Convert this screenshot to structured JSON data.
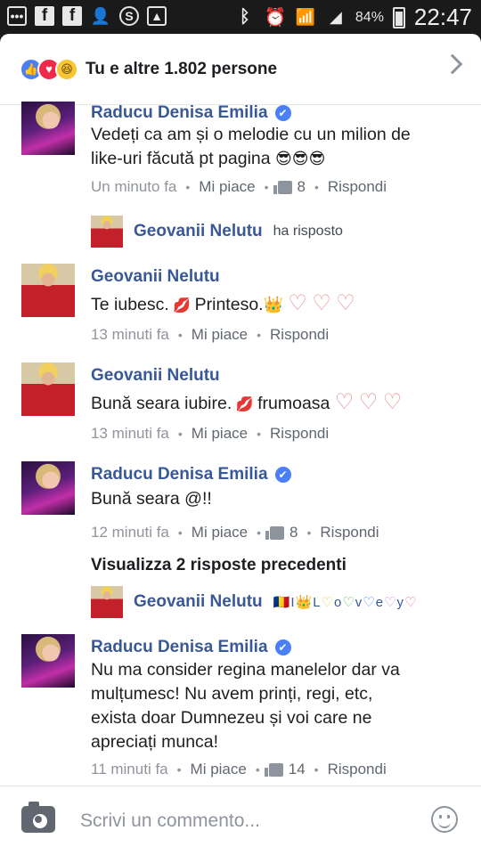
{
  "status_bar": {
    "time": "22:47",
    "battery": "84%",
    "left_icons": [
      "message-icon",
      "facebook-icon",
      "facebook-icon",
      "add-user-icon",
      "skype-icon",
      "gallery-icon"
    ],
    "right_icons": [
      "bluetooth-icon",
      "alarm-icon",
      "wifi-icon",
      "signal-icon",
      "battery-icon"
    ]
  },
  "reactions": {
    "icons": [
      "like",
      "love",
      "haha"
    ],
    "text": "Tu e altre 1.802 persone"
  },
  "comments": [
    {
      "author": "Raducu Denisa Emilia",
      "verified": true,
      "line1": "Vedeți ca am și o melodie cu un milion de",
      "line2": "like-uri făcută pt pagina",
      "emojis": "😎😎😎",
      "time": "Un minuto fa",
      "like_label": "Mi piace",
      "likes": "8",
      "reply_label": "Rispondi"
    },
    {
      "reply_author": "Geovanii Nelutu",
      "reply_status": "ha risposto"
    },
    {
      "author": "Geovanii Nelutu",
      "text_a": "Te iubesc.",
      "text_b": "Printeso.",
      "time": "13 minuti fa",
      "like_label": "Mi piace",
      "reply_label": "Rispondi"
    },
    {
      "author": "Geovanii Nelutu",
      "text_a": "Bună seara iubire.",
      "text_b": "frumoasa",
      "time": "13 minuti fa",
      "like_label": "Mi piace",
      "reply_label": "Rispondi"
    },
    {
      "author": "Raducu Denisa Emilia",
      "verified": true,
      "text": "Bună seara @!!",
      "time": "12 minuti fa",
      "like_label": "Mi piace",
      "likes": "8",
      "reply_label": "Rispondi"
    },
    {
      "view_previous": "Visualizza 2 risposte precedenti",
      "reply_author": "Geovanii Nelutu",
      "reply_letters": [
        "I",
        "L",
        "o",
        "v",
        "e",
        "y"
      ]
    },
    {
      "author": "Raducu Denisa Emilia",
      "verified": true,
      "line1": "Nu ma consider regina manelelor dar va",
      "line2": "mulțumesc! Nu avem prinți, regi, etc,",
      "line3": "exista doar Dumnezeu și voi care ne",
      "line4": "apreciați munca!",
      "time": "11 minuti fa",
      "like_label": "Mi piace",
      "likes": "14",
      "reply_label": "Rispondi"
    }
  ],
  "composer": {
    "placeholder": "Scrivi un commento..."
  },
  "colors": {
    "name_blue": "#385898",
    "meta_gray": "#90949c",
    "like_blue": "#4a7ff5",
    "love_red": "#f0284a",
    "haha_yellow": "#f7c634"
  }
}
